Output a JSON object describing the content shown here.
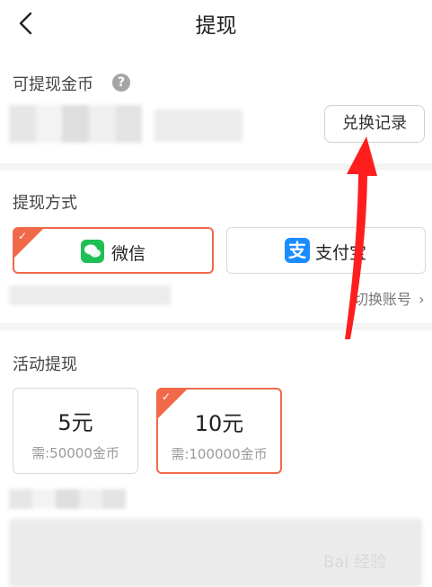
{
  "header": {
    "title": "提现"
  },
  "coins": {
    "label": "可提现金币"
  },
  "redeem": {
    "label": "兑换记录"
  },
  "methods": {
    "label": "提现方式",
    "options": [
      {
        "label": "微信",
        "selected": true
      },
      {
        "label": "支付宝",
        "selected": false
      }
    ],
    "switch_label": "切换账号"
  },
  "activity": {
    "label": "活动提现",
    "options": [
      {
        "amount": "5元",
        "cost": "需:50000金币",
        "selected": false
      },
      {
        "amount": "10元",
        "cost": "需:100000金币",
        "selected": true
      }
    ]
  },
  "colors": {
    "accent": "#f06a4a",
    "wechat": "#1fbf55",
    "alipay": "#1a8cff",
    "annotation_arrow": "#ff1e1e"
  },
  "watermark": {
    "text": "Bai 经验"
  }
}
